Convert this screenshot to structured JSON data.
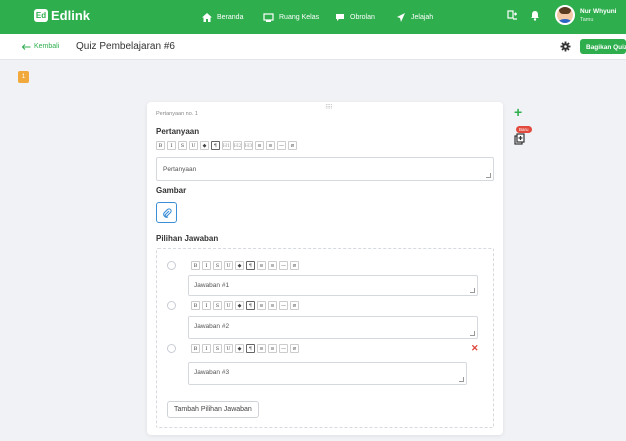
{
  "brand": {
    "name": "Edlink",
    "mark": "Ed"
  },
  "nav": [
    {
      "label": "Beranda",
      "icon": "home-icon"
    },
    {
      "label": "Ruang Kelas",
      "icon": "classroom-icon"
    },
    {
      "label": "Obrolan",
      "icon": "chat-icon"
    },
    {
      "label": "Jelajah",
      "icon": "explore-icon"
    }
  ],
  "user": {
    "name": "Nur Whyuni",
    "role": "Tamu"
  },
  "header": {
    "back_label": "Kembali",
    "title": "Quiz Pembelajaran #6",
    "share_label": "Bagikan Quiz"
  },
  "question_index": "1",
  "question": {
    "number_label": "Pertanyaan no. 1",
    "heading": "Pertanyaan",
    "placeholder": "Pertanyaan",
    "image_heading": "Gambar",
    "answers_heading": "Pilihan Jawaban",
    "answers": [
      {
        "placeholder": "Jawaban #1"
      },
      {
        "placeholder": "Jawaban #2"
      },
      {
        "placeholder": "Jawaban #3"
      }
    ],
    "add_answer_label": "Tambah Pilihan Jawaban"
  },
  "toolbar_buttons": [
    "B",
    "I",
    "S",
    "U",
    "◆",
    "¶",
    "H1",
    "H2",
    "H3",
    "≡",
    "≡",
    "—",
    "⊘"
  ],
  "answer_toolbar_buttons": [
    "B",
    "I",
    "S",
    "U",
    "◆",
    "¶",
    "≡",
    "≡",
    "—",
    "⊘"
  ],
  "side": {
    "new_badge": "Baru"
  },
  "colors": {
    "primary": "#2fae4e",
    "accent": "#f2a93b",
    "danger": "#e0443a",
    "link": "#3c8fd6"
  }
}
